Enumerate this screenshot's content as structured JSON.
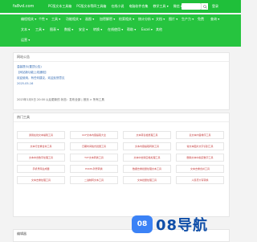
{
  "header": {
    "logo": "fa8vd.com",
    "links": [
      "PC版文本工具箱",
      "PC版文本等四工具箱",
      "在线小说",
      "电脑软件合集",
      "教学工具 ▾",
      "微信 ▾"
    ],
    "login": "登录"
  },
  "nav": {
    "row1": [
      "编程相关 ▾",
      "个性 ▾",
      "工具 ▾",
      "功能相关 ▾",
      "画图 ▾",
      "加密解密 ▾",
      "检索相关 ▾",
      "统计分析 ▾",
      "文档 ▾",
      "图片 ▾",
      "生产力 ▾",
      "免费",
      "查询 ▾"
    ],
    "row2": [
      "文本 ▾",
      "工具 ▾",
      "图表 ▾",
      "数据 ▾",
      "安全 ▾",
      "转换 ▾",
      "在线使用 ▾",
      "帮助 ▾",
      "Excel ▾",
      "其他"
    ],
    "row3": [
      "运营 ▾"
    ]
  },
  "notice": {
    "title": "网站公告",
    "lines": [
      "温馨提示(置顶公告)",
      "【网站新功能上线通知】",
      "欢迎使用，有任何建议，欢迎反馈意见",
      "2025-05-16"
    ],
    "meta": "2023年1月5日 20:00 以后更新的 状态：发布全部 | 首页 > 所有工具"
  },
  "hot_tools": {
    "title": "热门工具",
    "items": [
      "通用在线文本编辑工具",
      "UCF文本内容提取大全",
      "文本转表格整理工具",
      "表文本内容排序工具",
      "文本行去重合并工具",
      "日期时间格式批量工具",
      "文本内容提取转换工具",
      "常文本图片文字识别工具",
      "文本中去数字处理工具",
      "TXT文本转换工具",
      "文本中去除空格处理工具",
      "删除文本中指定数字工具",
      "手机号码生成器",
      "EXCEL列号转换",
      "数据去重批量处理文本工具",
      "文本去重合并工具",
      "文本去重处理工具",
      "二进制转文本工具",
      "文本批量处理工具",
      "人民币大写转换"
    ]
  },
  "bottom": {
    "title": "编辑器",
    "items": [
      "文本编辑工具",
      "代码在线工具",
      "文本格式化工具",
      "Markdown编辑器"
    ]
  },
  "watermark": {
    "text": "08导航",
    "badge": "08"
  },
  "colors": {
    "header": "#1fbf3a",
    "nav": "#26c43f",
    "tool_text": "#c43a3a",
    "watermark": "#0f4ea8"
  }
}
